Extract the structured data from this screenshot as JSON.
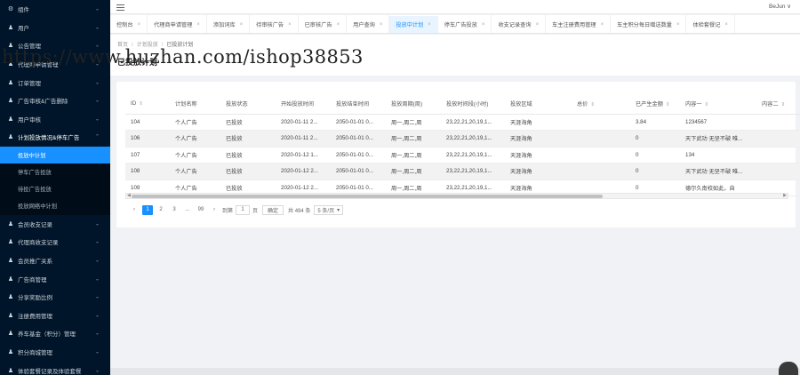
{
  "sidebar": {
    "items": [
      {
        "label": "组件",
        "icon": "gear-icon",
        "open": false
      },
      {
        "label": "用户",
        "icon": "user-icon",
        "open": false
      },
      {
        "label": "公告管理",
        "icon": "user-icon",
        "open": false
      },
      {
        "label": "代理商申请管理",
        "icon": "user-icon",
        "open": false
      },
      {
        "label": "订单管理",
        "icon": "user-icon",
        "open": false
      },
      {
        "label": "广告审核&广告删除",
        "icon": "user-icon",
        "open": false
      },
      {
        "label": "用户审核",
        "icon": "user-icon",
        "open": false
      },
      {
        "label": "计划投放情况&停车广告",
        "icon": "user-icon",
        "open": true
      }
    ],
    "submenu": [
      {
        "label": "投放中计划",
        "active": true
      },
      {
        "label": "停车广告投放",
        "active": false
      },
      {
        "label": "待投广告投放",
        "active": false
      },
      {
        "label": "投放网络中计划",
        "active": false
      }
    ],
    "items_after": [
      {
        "label": "会员收支记录",
        "icon": "user-icon"
      },
      {
        "label": "代理商收支记录",
        "icon": "user-icon"
      },
      {
        "label": "会员推广关系",
        "icon": "user-icon"
      },
      {
        "label": "广告商管理",
        "icon": "user-icon"
      },
      {
        "label": "分享奖励比例",
        "icon": "user-icon"
      },
      {
        "label": "注册费用管理",
        "icon": "user-icon"
      },
      {
        "label": "养车基金（积分）管理",
        "icon": "user-icon"
      },
      {
        "label": "积分商城管理",
        "icon": "user-icon"
      },
      {
        "label": "体验套餐记录及体验套餐",
        "icon": "user-icon"
      }
    ]
  },
  "header": {
    "user": "BeJun ∨"
  },
  "tabs": [
    {
      "label": "控制台",
      "active": false
    },
    {
      "label": "代理商申请管理",
      "active": false
    },
    {
      "label": "添加词库",
      "active": false
    },
    {
      "label": "待审核广告",
      "active": false
    },
    {
      "label": "已审核广告",
      "active": false
    },
    {
      "label": "用户查询",
      "active": false
    },
    {
      "label": "投放中计划",
      "active": true
    },
    {
      "label": "停车广告投放",
      "active": false
    },
    {
      "label": "收支记录查询",
      "active": false
    },
    {
      "label": "车主注册费用管理",
      "active": false
    },
    {
      "label": "车主积分每日赠送数量",
      "active": false
    },
    {
      "label": "体验套餐记",
      "active": false
    }
  ],
  "breadcrumb": {
    "home": "首页",
    "parent": "计划投放",
    "current": "已投放计划"
  },
  "page_title": "已投放计划",
  "watermark": "https://www.huzhan.com/ishop38853",
  "table": {
    "columns": [
      "ID",
      "计划名称",
      "投放状态",
      "开始投放时间",
      "投放结束时间",
      "投放周期(周)",
      "投放时间段(小时)",
      "投放区域",
      "总价",
      "已产生金额",
      "内容一",
      "内容二"
    ],
    "sortable": [
      true,
      false,
      false,
      false,
      false,
      false,
      false,
      false,
      true,
      true,
      true,
      true
    ],
    "rows": [
      [
        "104",
        "个人广告",
        "已投放",
        "2020-01-11 2...",
        "2050-01-01 0...",
        "周一,周二,周",
        "23,22,21,20,19,1...",
        "天涯海角",
        "",
        "3.84",
        "1234567",
        ""
      ],
      [
        "106",
        "个人广告",
        "已投放",
        "2020-01-11 2...",
        "2050-01-01 0...",
        "周一,周二,周",
        "23,22,21,20,19,1...",
        "天涯海角",
        "",
        "0",
        "天下武功 无坚不破 唯...",
        ""
      ],
      [
        "107",
        "个人广告",
        "已投放",
        "2020-01-12 1...",
        "2050-01-01 0...",
        "周一,周二,周",
        "23,22,21,20,19,1...",
        "天涯海角",
        "",
        "0",
        "134",
        ""
      ],
      [
        "108",
        "个人广告",
        "已投放",
        "2020-01-12 2...",
        "2050-01-01 0...",
        "周一,周二,周",
        "23,22,21,20,19,1...",
        "天涯海角",
        "",
        "0",
        "天下武功 无坚不破 唯...",
        ""
      ],
      [
        "109",
        "个人广告",
        "已投放",
        "2020-01-12 2...",
        "2050-01-01 0...",
        "周一,周二,周",
        "23,22,21,20,19,1...",
        "天涯海角",
        "",
        "0",
        "德尔久南校如此，自",
        ""
      ]
    ]
  },
  "pager": {
    "prev": "‹",
    "pages": [
      "1",
      "2",
      "3",
      "...",
      "99"
    ],
    "next": "›",
    "goto_label": "到第",
    "goto_value": "1",
    "page_unit": "页",
    "confirm": "确定",
    "total": "共 494 条",
    "page_size": "5 条/页"
  },
  "colors": {
    "sidebar_bg": "#001529",
    "accent": "#1890ff"
  }
}
